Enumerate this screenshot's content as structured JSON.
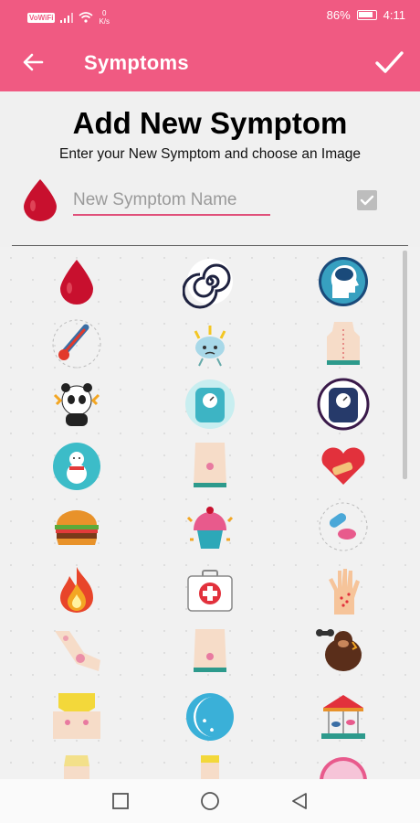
{
  "status_bar": {
    "network_badge": "VoWiFi",
    "net_speed_value": "0",
    "net_speed_unit": "K/s",
    "battery": "86%",
    "time": "4:11"
  },
  "app_bar": {
    "title": "Symptoms",
    "back_icon": "arrow-left-icon",
    "confirm_icon": "checkmark-icon"
  },
  "header": {
    "title": "Add New Symptom",
    "subtitle": "Enter your New Symptom and choose an Image"
  },
  "form": {
    "selected_icon": "blood-drop-icon",
    "name_value": "",
    "name_placeholder": "New Symptom Name",
    "checkbox_checked": true
  },
  "icon_grid": [
    "blood-drop-icon",
    "spiral-dizziness-icon",
    "brain-head-icon",
    "thermometer-fever-icon",
    "brain-headache-icon",
    "back-pain-icon",
    "panda-stress-icon",
    "weight-scale-teal-icon",
    "weight-scale-navy-icon",
    "snowman-chills-icon",
    "bare-stomach-icon",
    "heart-bandage-icon",
    "burger-craving-icon",
    "cupcake-craving-icon",
    "pill-medicine-icon",
    "fire-hot-flash-icon",
    "first-aid-kit-icon",
    "hand-rash-icon",
    "knee-elbow-pain-icon",
    "lower-back-pain-icon",
    "gorilla-angry-icon",
    "breast-tenderness-icon",
    "moon-night-sweats-icon",
    "carousel-mood-swings-icon"
  ],
  "colors": {
    "accent": "#f05a82",
    "input_underline": "#e0507a",
    "checkbox": "#bdbdbd"
  },
  "nav_bar": [
    "recents-square-icon",
    "home-circle-icon",
    "back-triangle-icon"
  ]
}
